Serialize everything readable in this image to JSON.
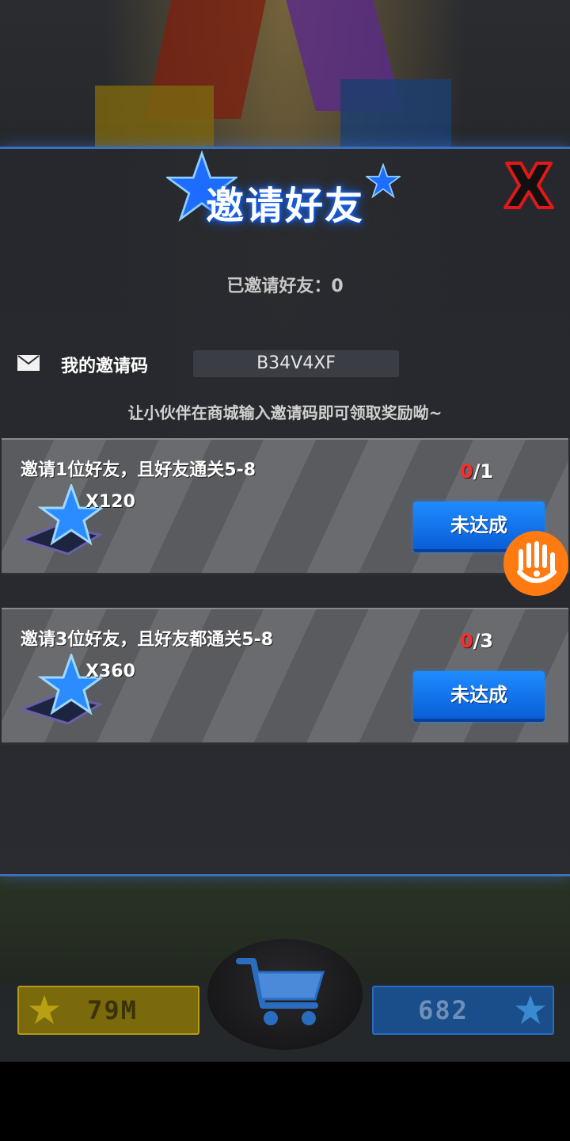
{
  "dialog": {
    "title": "邀请好友",
    "invited_label": "已邀请好友：",
    "invited_count": "0",
    "close_icon": "close-x-icon"
  },
  "invite_code": {
    "label": "我的邀请码",
    "value": "B34V4XF",
    "icon": "mail-icon"
  },
  "hint": "让小伙伴在商城输入邀请码即可领取奖励呦~",
  "tasks": [
    {
      "title": "邀请1位好友，且好友通关5-8",
      "progress_current": "0",
      "progress_total": "/1",
      "reward_icon": "blue-star-icon",
      "reward_qty": "X120",
      "button": "未达成"
    },
    {
      "title": "邀请3位好友，且好友都通关5-8",
      "progress_current": "0",
      "progress_total": "/3",
      "reward_icon": "blue-star-icon",
      "reward_qty": "X360",
      "button": "未达成"
    }
  ],
  "bottom": {
    "gold": "79M",
    "gems": "682",
    "cart_icon": "shopping-cart-icon"
  },
  "colors": {
    "accent_blue": "#1e8cff",
    "progress_red": "#ff2a2a",
    "float_orange": "#ff7a10",
    "gold": "#b49a10"
  }
}
